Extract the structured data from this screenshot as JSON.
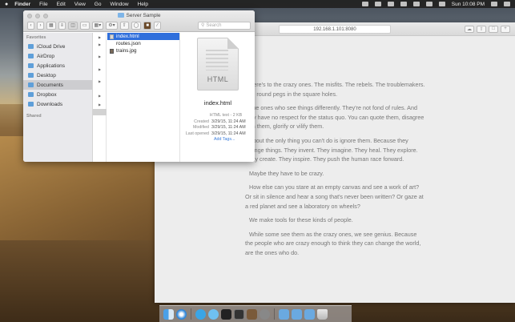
{
  "menubar": {
    "apple": "",
    "items": [
      "Finder",
      "File",
      "Edit",
      "View",
      "Go",
      "Window",
      "Help"
    ],
    "clock": "Sun 10:08 PM"
  },
  "browser": {
    "url": "192.168.1.101:8080",
    "paragraphs": [
      "Here's to the crazy ones. The misfits. The rebels. The troublemakers. The round pegs in the square holes.",
      "The ones who see things differently. They're not fond of rules. And they have no respect for the status quo. You can quote them, disagree with them, glorify or vilify them.",
      "About the only thing you can't do is ignore them. Because they change things. They invent. They imagine. They heal. They explore. They create. They inspire. They push the human race forward.",
      "Maybe they have to be crazy.",
      "How else can you stare at an empty canvas and see a work of art? Or sit in silence and hear a song that's never been written? Or gaze at a red planet and see a laboratory on wheels?",
      "We make tools for these kinds of people.",
      "While some see them as the crazy ones, we see genius. Because the people who are crazy enough to think they can change the world, are the ones who do."
    ]
  },
  "finder": {
    "title": "Server Sample",
    "search_placeholder": "Search",
    "sidebar": {
      "favorites_header": "Favorites",
      "favorites": [
        "iCloud Drive",
        "AirDrop",
        "Applications",
        "Desktop",
        "Documents",
        "Dropbox",
        "Downloads"
      ],
      "selected": "Documents",
      "shared_header": "Shared"
    },
    "files": [
      "index.html",
      "routes.json",
      "trains.jpg"
    ],
    "selected_file": "index.html",
    "preview": {
      "icon_label": "HTML",
      "name": "index.html",
      "kind": "HTML text - 2 KB",
      "created_label": "Created",
      "created": "3/29/15, 11:24 AM",
      "modified_label": "Modified",
      "modified": "3/29/15, 11:24 AM",
      "opened_label": "Last opened",
      "opened": "3/29/15, 11:24 AM",
      "tags": "Add Tags..."
    }
  },
  "dock": {
    "icons": [
      "finder",
      "safari",
      "app-store",
      "messages",
      "terminal",
      "activity",
      "preview",
      "mic",
      "folder",
      "folder",
      "folder",
      "trash"
    ]
  },
  "colors": {
    "selection": "#2f6fdc",
    "folder": "#7eb5e8",
    "link": "#3b7ddb"
  }
}
